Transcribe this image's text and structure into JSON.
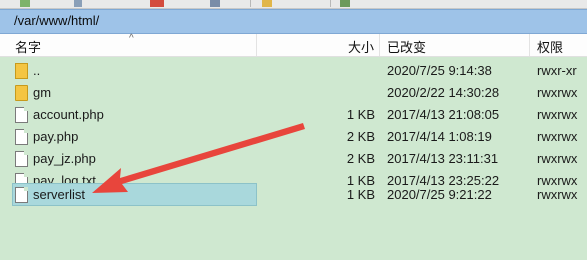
{
  "path_bar": {
    "path": "/var/www/html/"
  },
  "columns": {
    "name": "名字",
    "size": "大小",
    "modified": "已改变",
    "permissions": "权限"
  },
  "rows": [
    {
      "name": "..",
      "size": "",
      "modified": "2020/7/25 9:14:38",
      "permissions": "rwxr-xr",
      "icon": "parent-folder-icon"
    },
    {
      "name": "gm",
      "size": "",
      "modified": "2020/2/22 14:30:28",
      "permissions": "rwxrwx",
      "icon": "folder-icon"
    },
    {
      "name": "account.php",
      "size": "1 KB",
      "modified": "2017/4/13 21:08:05",
      "permissions": "rwxrwx",
      "icon": "file-icon"
    },
    {
      "name": "pay.php",
      "size": "2 KB",
      "modified": "2017/4/14 1:08:19",
      "permissions": "rwxrwx",
      "icon": "file-icon"
    },
    {
      "name": "pay_jz.php",
      "size": "2 KB",
      "modified": "2017/4/13 23:11:31",
      "permissions": "rwxrwx",
      "icon": "file-icon"
    },
    {
      "name": "pay_log.txt",
      "size": "1 KB",
      "modified": "2017/4/13 23:25:22",
      "permissions": "rwxrwx",
      "icon": "file-icon"
    },
    {
      "name": "serverlist",
      "size": "1 KB",
      "modified": "2020/7/25 9:21:22",
      "permissions": "rwxrwx",
      "icon": "file-icon",
      "selected": true
    }
  ],
  "colors": {
    "list_bg": "#cfe8d0",
    "path_bar_bg": "#9ec3e8",
    "selection": "#a9d8dc",
    "annotation_arrow": "#e8453c"
  }
}
